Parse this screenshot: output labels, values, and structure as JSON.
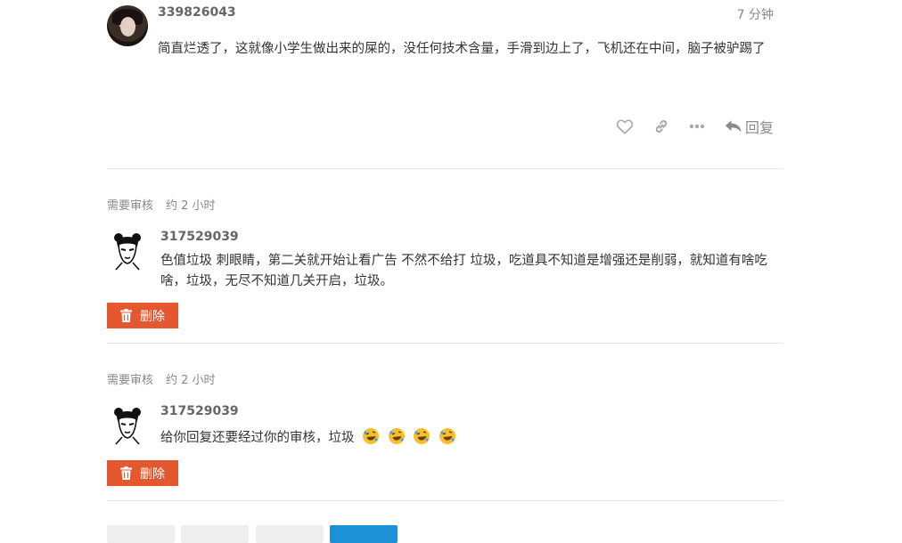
{
  "comments": {
    "first": {
      "username": "339826043",
      "time": "7 分钟",
      "text": "简直烂透了，这就像小学生做出来的屎的，没任何技术含量，手滑到边上了，飞机还在中间，脑子被驴踢了",
      "actions": {
        "like_icon": "heart-icon",
        "link_icon": "link-icon",
        "more_icon": "more-icon",
        "reply_label": "回复"
      }
    },
    "pending": [
      {
        "status": "需要审核",
        "time": "约 2 小时",
        "username": "317529039",
        "text": "色值垃圾 刺眼睛，第二关就开始让看广告 不然不给打 垃圾，吃道具不知道是增强还是削弱，就知道有啥吃啥，垃圾，无尽不知道几关开启，垃圾。",
        "delete_label": "删除"
      },
      {
        "status": "需要审核",
        "time": "约 2 小时",
        "username": "317529039",
        "text": "给你回复还要经过你的审核，垃圾",
        "emoji": [
          "rofl-emoji",
          "rofl-emoji",
          "rofl-emoji",
          "rofl-emoji"
        ],
        "delete_label": "删除"
      }
    ]
  },
  "colors": {
    "danger": "#e4582f",
    "primary": "#1e90d6",
    "muted": "#888888"
  }
}
